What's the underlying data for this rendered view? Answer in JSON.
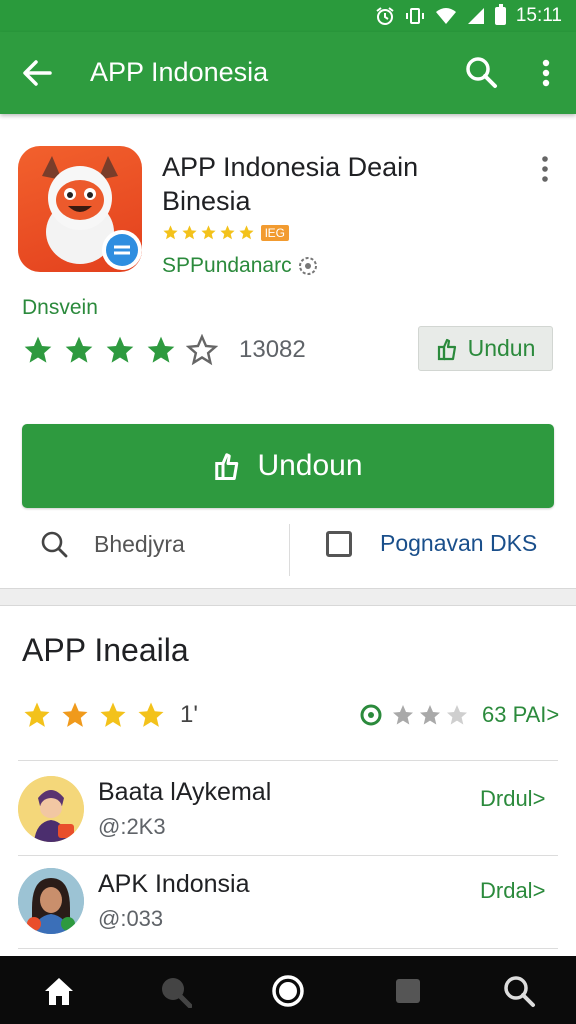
{
  "status_bar": {
    "time": "15:11",
    "icons": [
      "alarm-icon",
      "vibrate-icon",
      "wifi-icon",
      "signal-icon",
      "battery-icon"
    ]
  },
  "app_bar": {
    "title": "APP Indonesia",
    "icons": [
      "back-arrow-icon",
      "search-icon",
      "more-vert-icon"
    ],
    "color": "#2e9c3f"
  },
  "app_card": {
    "name": "APP Indonesia Deain Binesia",
    "badge": "lEG",
    "developer": "SPPundanarc",
    "section_label": "Dnsvein",
    "rating_stars": 4,
    "rating_max": 5,
    "rating_count": "13082",
    "small_button_label": "Undun",
    "install_button_label": "Undoun",
    "tool_left_label": "Bhedjyra",
    "tool_right_label": "Pognavan DKS"
  },
  "reviews": {
    "title": "APP Ineaila",
    "stars": 4,
    "count": "1'",
    "summary_grey_stars": 3,
    "summary_link": "63 PAI>",
    "items": [
      {
        "name": "Baata lAykemal",
        "sub": "@:2K3",
        "action": "Drdul>"
      },
      {
        "name": "APK Indonsia",
        "sub": "@:033",
        "action": "Drdal>"
      }
    ]
  },
  "nav_bar": {
    "icons": [
      "home-icon",
      "discover-icon",
      "circle-home-icon",
      "square-icon",
      "search-icon"
    ]
  },
  "colors": {
    "primary_green": "#2e9a3f",
    "text_green": "#2b8a3c",
    "star_green": "#2e9a3f",
    "star_gold": "#f3c21b",
    "link_blue": "#1a4f8b"
  }
}
